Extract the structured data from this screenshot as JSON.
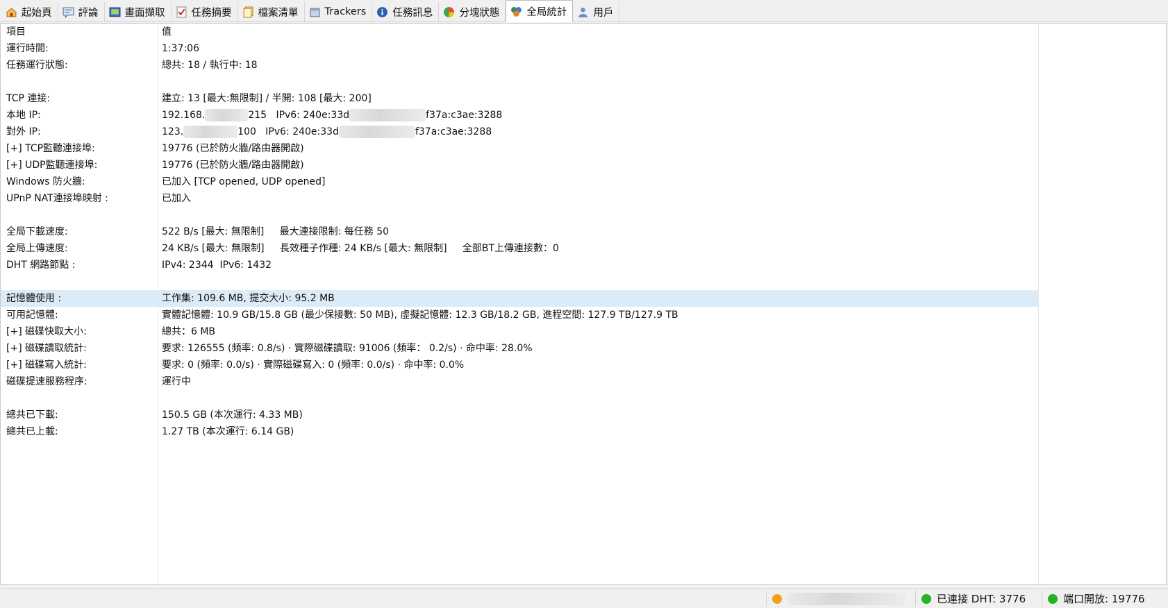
{
  "tabs": [
    {
      "label": "起始頁",
      "icon": "home-icon",
      "name": "tab-start"
    },
    {
      "label": "評論",
      "icon": "comment-icon",
      "name": "tab-comments"
    },
    {
      "label": "畫面擷取",
      "icon": "screenshot-icon",
      "name": "tab-screenshots"
    },
    {
      "label": "任務摘要",
      "icon": "checklist-icon",
      "name": "tab-task-summary"
    },
    {
      "label": "檔案清單",
      "icon": "files-icon",
      "name": "tab-file-list"
    },
    {
      "label": "Trackers",
      "icon": "trackers-icon",
      "name": "tab-trackers"
    },
    {
      "label": "任務訊息",
      "icon": "info-icon",
      "name": "tab-task-info"
    },
    {
      "label": "分塊狀態",
      "icon": "pie-chart-icon",
      "name": "tab-piece-status"
    },
    {
      "label": "全局統計",
      "icon": "global-stats-icon",
      "name": "tab-global-stats",
      "active": true
    },
    {
      "label": "用戶",
      "icon": "users-icon",
      "name": "tab-users"
    }
  ],
  "table": {
    "header": {
      "key": "項目",
      "value": "值"
    },
    "rows": {
      "uptime": {
        "k": "運行時間:",
        "v": "1:37:06"
      },
      "task_state": {
        "k": "任務運行狀態:",
        "v": "總共: 18 / 執行中: 18"
      },
      "tcp": {
        "k": "TCP 連接:",
        "v": "建立: 13 [最大:無限制] / 半開: 108 [最大: 200]"
      },
      "local_ip": {
        "k": "本地 IP:",
        "v_a": "192.168.",
        "v_b": "215",
        "v_c": "IPv6: 240e:33d",
        "v_d": "f37a:c3ae:3288"
      },
      "public_ip": {
        "k": "對外 IP:",
        "v_a": "123.",
        "v_b": "100",
        "v_c": "IPv6: 240e:33d",
        "v_d": "f37a:c3ae:3288"
      },
      "tcp_listen": {
        "k": "[+] TCP監聽連接埠:",
        "v": "19776 (已於防火牆/路由器開啟)"
      },
      "udp_listen": {
        "k": "[+] UDP監聽連接埠:",
        "v": "19776 (已於防火牆/路由器開啟)"
      },
      "firewall": {
        "k": "Windows 防火牆:",
        "v": "已加入 [TCP opened, UDP opened]"
      },
      "upnp": {
        "k": "UPnP NAT連接埠映射 :",
        "v": "已加入"
      },
      "down_speed": {
        "k": "全局下載速度:",
        "v": "522 B/s [最大: 無限制]     最大連接限制: 每任務 50"
      },
      "up_speed": {
        "k": "全局上傳速度:",
        "v": "24 KB/s [最大: 無限制]     長效種子作種: 24 KB/s [最大: 無限制]     全部BT上傳連接數：0"
      },
      "dht": {
        "k": "DHT 網路節點 :",
        "v": "IPv4: 2344  IPv6: 1432"
      },
      "memory": {
        "k": "記憶體使用 :",
        "v": "工作集: 109.6 MB, 提交大小: 95.2 MB"
      },
      "avail_mem": {
        "k": "可用記憶體:",
        "v": "實體記憶體: 10.9 GB/15.8 GB (最少保接數: 50 MB), 虛擬記憶體: 12.3 GB/18.2 GB, 進程空間: 127.9 TB/127.9 TB"
      },
      "disk_cache": {
        "k": "[+] 磁碟快取大小:",
        "v": "總共：6 MB"
      },
      "disk_read": {
        "k": "[+] 磁碟讀取統計:",
        "v": "要求: 126555 (頻率: 0.8/s) · 實際磁碟讀取: 91006 (頻率： 0.2/s) · 命中率: 28.0%"
      },
      "disk_write": {
        "k": "[+] 磁碟寫入統計:",
        "v": "要求: 0 (頻率: 0.0/s) · 實際磁碟寫入: 0 (頻率: 0.0/s) · 命中率: 0.0%"
      },
      "disk_svc": {
        "k": "磁碟提速服務程序:",
        "v": "運行中"
      },
      "total_down": {
        "k": "總共已下載:",
        "v": "150.5 GB (本次運行: 4.33 MB)"
      },
      "total_up": {
        "k": "總共已上載:",
        "v": "1.27 TB (本次運行: 6.14 GB)"
      }
    }
  },
  "status": {
    "dht": "已連接 DHT: 3776",
    "port": "端口開放: 19776"
  },
  "colors": {
    "highlight_row": "#dcebf8",
    "status_ok": "#22b422",
    "tray_orange": "#f0a020"
  }
}
